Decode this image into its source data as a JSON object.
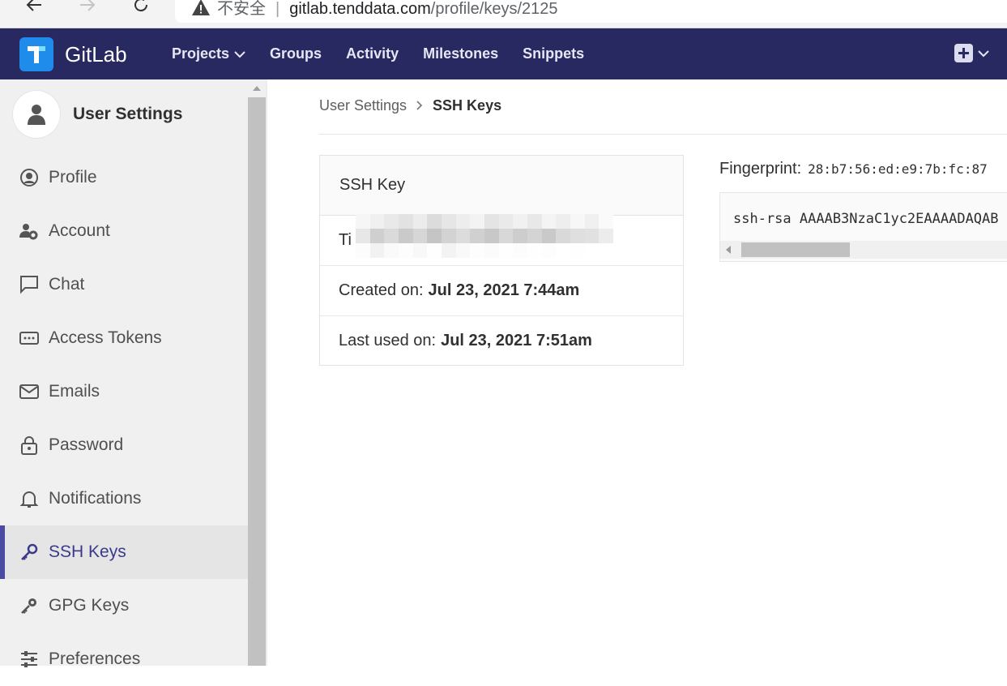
{
  "browser": {
    "security_label": "不安全",
    "url_host": "gitlab.tenddata.com",
    "url_path": "/profile/keys/2125"
  },
  "header": {
    "brand": "GitLab",
    "nav": [
      "Projects",
      "Groups",
      "Activity",
      "Milestones",
      "Snippets"
    ]
  },
  "sidebar": {
    "title": "User Settings",
    "items": [
      {
        "label": "Profile",
        "icon": "profile-icon"
      },
      {
        "label": "Account",
        "icon": "account-gear-icon"
      },
      {
        "label": "Chat",
        "icon": "chat-icon"
      },
      {
        "label": "Access Tokens",
        "icon": "token-icon"
      },
      {
        "label": "Emails",
        "icon": "mail-icon"
      },
      {
        "label": "Password",
        "icon": "lock-icon"
      },
      {
        "label": "Notifications",
        "icon": "bell-icon"
      },
      {
        "label": "SSH Keys",
        "icon": "key-icon",
        "active": true
      },
      {
        "label": "GPG Keys",
        "icon": "key-icon"
      },
      {
        "label": "Preferences",
        "icon": "sliders-icon"
      }
    ]
  },
  "breadcrumb": {
    "parent": "User Settings",
    "current": "SSH Keys"
  },
  "key_card": {
    "heading": "SSH Key",
    "title_prefix": "Ti",
    "created_label": "Created on:",
    "created_value": "Jul 23, 2021 7:44am",
    "last_used_label": "Last used on:",
    "last_used_value": "Jul 23, 2021 7:51am"
  },
  "fingerprint": {
    "label": "Fingerprint:",
    "value": "28:b7:56:ed:e9:7b:fc:87",
    "key_text": "ssh-rsa AAAAB3NzaC1yc2EAAAADAQAB"
  },
  "colors": {
    "header_bg": "#292961",
    "active_indicator": "#4b4ba3",
    "logo_bg": "#1f8ceb"
  }
}
